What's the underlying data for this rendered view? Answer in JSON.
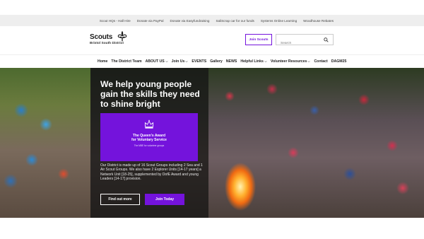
{
  "top_links": [
    "Scout HQs - Hall Hire",
    "Donate via PayPal",
    "Donate via Easyfundraising",
    "SaliScrap car for our funds",
    "Systems Online Learning",
    "Woodhouse Rebates"
  ],
  "brand": {
    "name": "Scouts",
    "subtitle": "Bristol South District",
    "logo_icon": "fleur-de-lis-icon",
    "accent": "#7413dc"
  },
  "header": {
    "join_label": "Join Scouts",
    "search_placeholder": "Search",
    "search_icon": "search-icon"
  },
  "nav": [
    {
      "label": "Home",
      "dropdown": false
    },
    {
      "label": "The District Team",
      "dropdown": false
    },
    {
      "label": "ABOUT US",
      "dropdown": true
    },
    {
      "label": "Join Us",
      "dropdown": true
    },
    {
      "label": "EVENTS",
      "dropdown": false
    },
    {
      "label": "Gallery",
      "dropdown": false
    },
    {
      "label": "NEWS",
      "dropdown": false
    },
    {
      "label": "Helpful Links",
      "dropdown": true
    },
    {
      "label": "Volunteer Resources",
      "dropdown": true
    },
    {
      "label": "Contact",
      "dropdown": false
    },
    {
      "label": "DAGM25",
      "dropdown": false
    }
  ],
  "hero": {
    "headline": "We help young people gain the skills they need to shine bright",
    "award": {
      "title_line1": "The Queen's Award",
      "title_line2": "for Voluntary Service",
      "subtitle": "The MBE for volunteer groups"
    },
    "body": "Our District is made up of 16 Scout Groups including 2 Sea and 1 Air Scout Groups. We also have 2 Explorer Units [14-17 years] a Network Unit [18-25], supplemented by DofE Award and young Leaders [14-17] provision.",
    "find_out_more": "Find out more",
    "join_today": "Join Today"
  }
}
